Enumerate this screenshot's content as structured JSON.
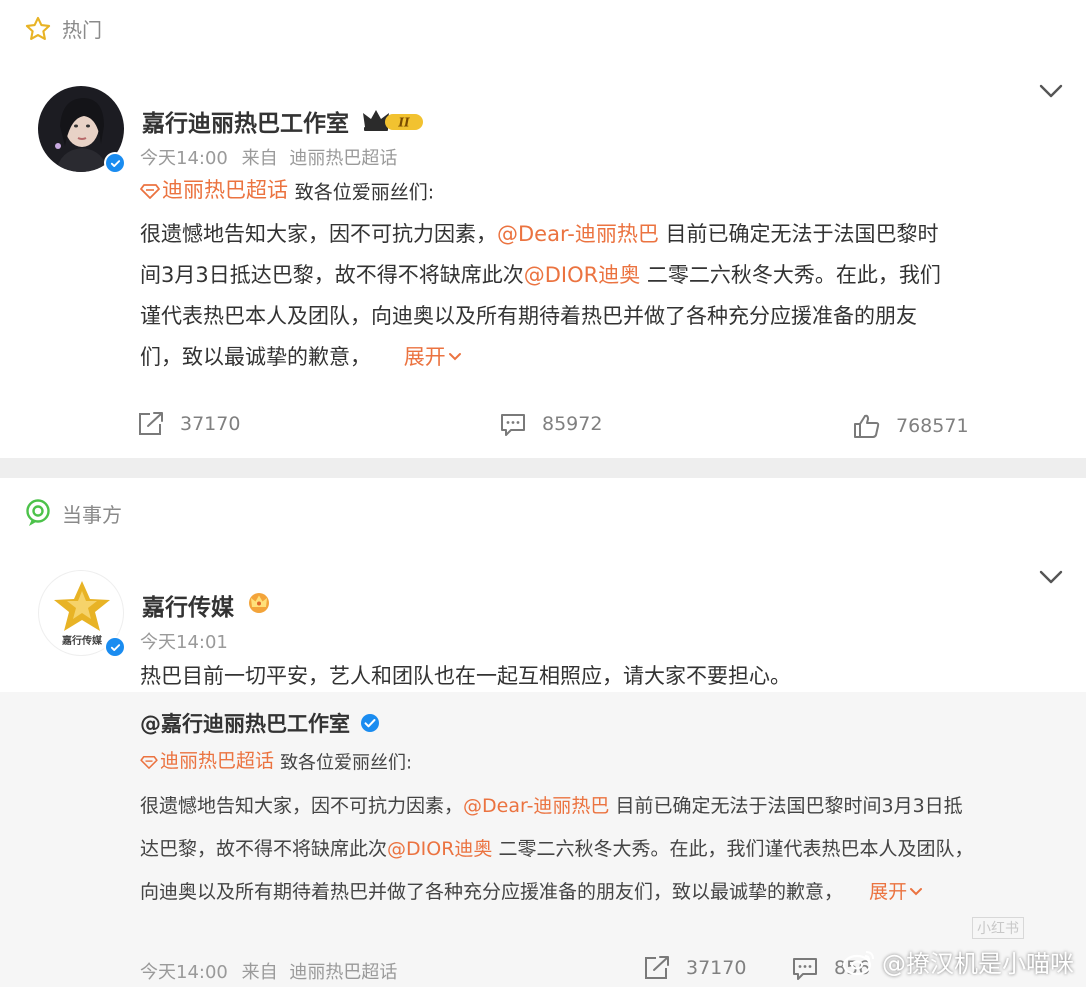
{
  "post1": {
    "section_label": "热门",
    "username": "嘉行迪丽热巴工作室",
    "badge_text": "II",
    "time": "今天14:00",
    "source_prefix": "来自",
    "source": "迪丽热巴超话",
    "topic": "迪丽热巴超话",
    "intro": "致各位爱丽丝们:",
    "lines": {
      "l1a": "很遗憾地告知大家，因不可抗力因素，",
      "l1m": "@Dear-迪丽热巴",
      "l1b": " 目前已确定无法于法国巴黎时",
      "l2a": "间3月3日抵达巴黎，故不得不将缺席此次",
      "l2m": "@DIOR迪奥",
      "l2b": " 二零二六秋冬大秀。在此，我们",
      "l3": "谨代表热巴本人及团队，向迪奥以及所有期待着热巴并做了各种充分应援准备的朋友",
      "l4": "们，致以最诚挚的歉意，"
    },
    "expand_label": "展开",
    "reposts": "37170",
    "comments": "85972",
    "likes": "768571"
  },
  "post2": {
    "section_label": "当事方",
    "username": "嘉行传媒",
    "avatar_text": "嘉行传媒",
    "time": "今天14:01",
    "content": "热巴目前一切平安，艺人和团队也在一起互相照应，请大家不要担心。",
    "repost": {
      "username": "@嘉行迪丽热巴工作室",
      "topic": "迪丽热巴超话",
      "intro": "致各位爱丽丝们:",
      "lines": {
        "l1a": "很遗憾地告知大家，因不可抗力因素，",
        "l1m": "@Dear-迪丽热巴",
        "l1b": " 目前已确定无法于法国巴黎时间3月3日抵",
        "l2a": "达巴黎，故不得不将缺席此次",
        "l2m": "@DIOR迪奥",
        "l2b": " 二零二六秋冬大秀。在此，我们谨代表热巴本人及团队，",
        "l3": "向迪奥以及所有期待着热巴并做了各种充分应援准备的朋友们，致以最诚挚的歉意，"
      },
      "expand_label": "展开",
      "time": "今天14:00",
      "source_prefix": "来自",
      "source": "迪丽热巴超话",
      "reposts": "37170",
      "comments_partial": "856"
    }
  },
  "watermark": {
    "text": "@撩汉机是小喵咪",
    "small_text": "小红书"
  },
  "colors": {
    "accent": "#eb7340",
    "verified": "#1a8cf0",
    "gold": "#e8b325"
  }
}
